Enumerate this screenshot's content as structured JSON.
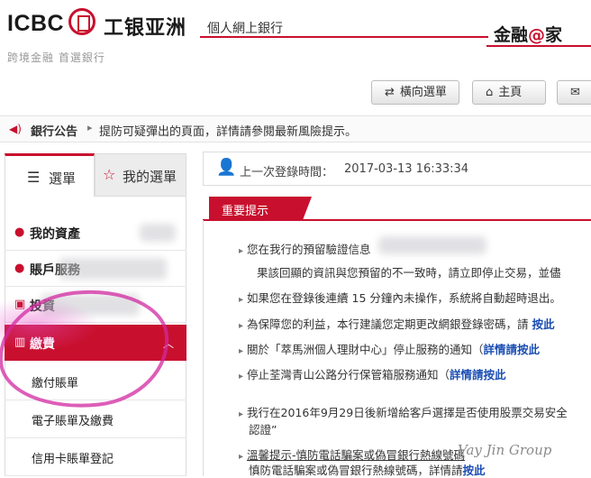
{
  "header": {
    "logo_text": "ICBC",
    "bank_name": "工银亚洲",
    "slogan": "跨境金融 首選銀行",
    "ebank_label": "個人網上銀行",
    "brand_pre": "金融",
    "brand_at": "@",
    "brand_post": "家"
  },
  "topnav": {
    "horizontal_menu": "橫向選單",
    "home": "主頁"
  },
  "announcement": {
    "label": "銀行公告",
    "text": "提防可疑彈出的頁面，詳情請參閱最新風險提示。"
  },
  "sidebar": {
    "tab_menu": "選單",
    "tab_my_menu": "我的選單",
    "items": [
      {
        "label": "我的資產"
      },
      {
        "label": "賬戶服務"
      },
      {
        "label": "投資"
      },
      {
        "label": "繳費"
      }
    ],
    "sub_items": [
      {
        "label": "繳付賬單"
      },
      {
        "label": "電子賬單及繳費"
      },
      {
        "label": "信用卡賬單登記"
      }
    ]
  },
  "login": {
    "label": "上一次登錄時間：",
    "time": "2017-03-13 16:33:34"
  },
  "notices": {
    "title": "重要提示",
    "lines": [
      {
        "text": "您在我行的預留驗證信息",
        "link": ""
      },
      {
        "text": "果該回顯的資訊與您預留的不一致時，請立即停止交易，並儘",
        "link": ""
      },
      {
        "text": "如果您在登錄後連續 15 分鐘內未操作，系統將自動超時退出。",
        "link": ""
      },
      {
        "text": "為保障您的利益，本行建議您定期更改網銀登錄密碼，請",
        "link": "按此"
      },
      {
        "text": "關於「萃馬洲個人理財中心」停止服務的通知（",
        "link": "詳情請按此"
      },
      {
        "text": "停止荃灣青山公路分行保管箱服務通知（",
        "link": "詳情請按此"
      },
      {
        "text": "我行在2016年9月29日後新增給客戶選擇是否使用股票交易安全",
        "link": ""
      },
      {
        "text": "認證”",
        "link": ""
      },
      {
        "text": "溫馨提示-慎防電話騙案或偽冒銀行熱線號碼",
        "link": ""
      },
      {
        "text": "慎防電話騙案或偽冒銀行熱線號碼，詳情請",
        "link": "按此"
      }
    ]
  },
  "watermark": "Vay Jin Group"
}
